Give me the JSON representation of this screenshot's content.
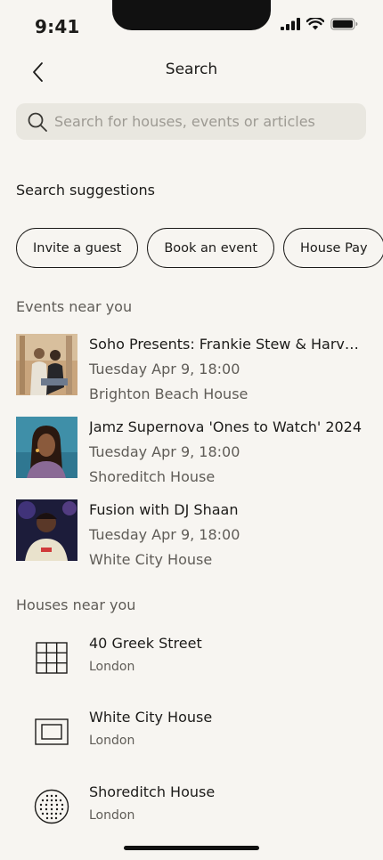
{
  "status_bar": {
    "time": "9:41"
  },
  "header": {
    "title": "Search",
    "back_icon": "chevron-left-icon"
  },
  "search": {
    "placeholder": "Search for houses, events or articles",
    "value": "",
    "icon": "search-icon"
  },
  "suggestions": {
    "heading": "Search suggestions",
    "chips": [
      "Invite a guest",
      "Book an event",
      "House Pay"
    ]
  },
  "events": {
    "heading": "Events near you",
    "items": [
      {
        "title": "Soho Presents: Frankie Stew & Harvey Gunn",
        "date": "Tuesday Apr 9, 18:00",
        "venue": "Brighton Beach House"
      },
      {
        "title": "Jamz Supernova 'Ones to Watch' 2024",
        "date": "Tuesday Apr 9, 18:00",
        "venue": "Shoreditch House"
      },
      {
        "title": "Fusion with DJ Shaan",
        "date": "Tuesday Apr 9, 18:00",
        "venue": "White City House"
      }
    ]
  },
  "houses": {
    "heading": "Houses near you",
    "items": [
      {
        "name": "40 Greek Street",
        "city": "London",
        "icon": "grid-icon"
      },
      {
        "name": "White City House",
        "city": "London",
        "icon": "frame-icon"
      },
      {
        "name": "Shoreditch House",
        "city": "London",
        "icon": "dotted-circle-icon"
      }
    ]
  },
  "colors": {
    "background": "#f7f5f1",
    "search_bg": "#e9e7e0",
    "text": "#1c1b19",
    "muted": "#5f5c57"
  }
}
